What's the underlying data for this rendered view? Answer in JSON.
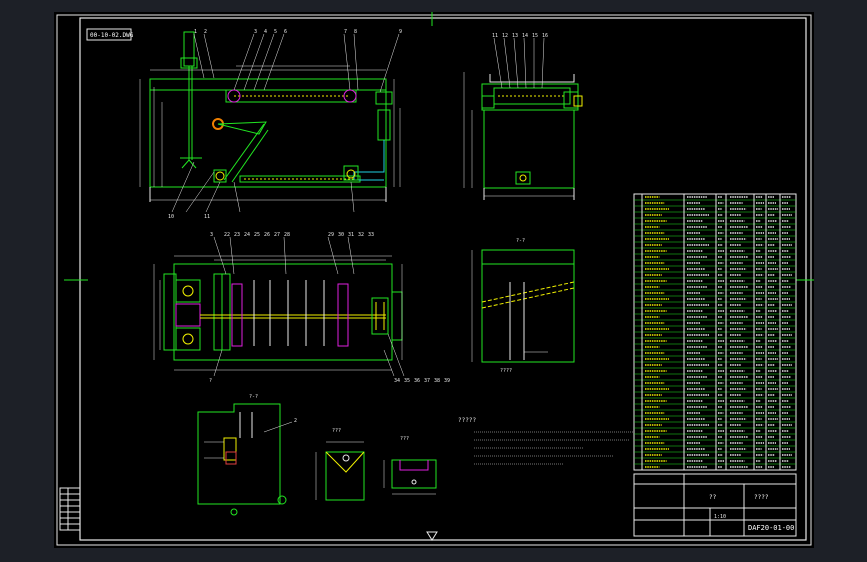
{
  "drawing": {
    "sheet_tag": "00-10-02.DWG",
    "drawing_number": "DAF20-01-00",
    "title_block_label": "????",
    "title_block_center": "??",
    "title_block_small": "1:10",
    "notes_heading": "?????",
    "section_label_top": "??-??",
    "section_label_right": "?-?",
    "detail_label_left": "?-?",
    "detail_label_mid1": "???",
    "detail_label_mid2": "???",
    "section_caption": "????",
    "view_label_bottom": "?",
    "part_numbers_front": [
      "1",
      "2",
      "3",
      "4",
      "5",
      "6",
      "7",
      "8",
      "9",
      "10",
      "11"
    ],
    "part_numbers_side": [
      "11",
      "12",
      "13",
      "14",
      "15",
      "16"
    ],
    "part_numbers_plan": [
      "3",
      "22",
      "23",
      "24",
      "25",
      "26",
      "27",
      "28",
      "29",
      "30",
      "31",
      "32",
      "33"
    ],
    "plan_bottom_numbers": [
      "34",
      "35",
      "36",
      "37",
      "38",
      "39"
    ]
  },
  "colors": {
    "background": "#000000",
    "viewer_bg": "#1d2027",
    "frame": "#e8e8e8",
    "outline": "#22e622",
    "hidden": "#f0f000",
    "accent": "#e020e0",
    "pipe": "#20d0e0",
    "marker": "#f08000"
  }
}
